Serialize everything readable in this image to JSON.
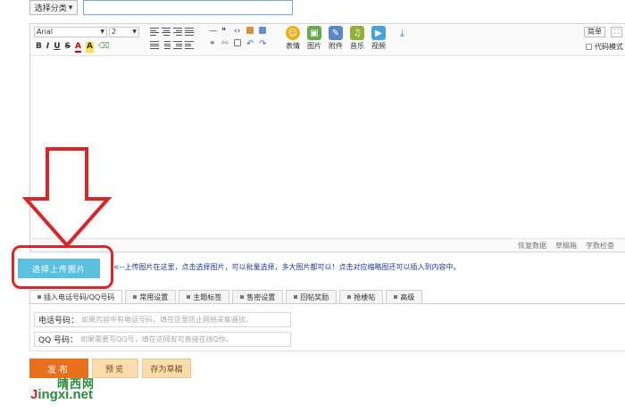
{
  "top": {
    "category_label": "选择分类",
    "category_arrow": "▾"
  },
  "toolbar": {
    "font_value": "Arial",
    "size_value": "2",
    "bold": "B",
    "italic": "I",
    "underline": "U",
    "strike": "S",
    "font_color": "A",
    "bg_color": "A",
    "media": [
      {
        "label": "表情",
        "color": "#e8b017",
        "glyph": "☺"
      },
      {
        "label": "图片",
        "color": "#6aa84f",
        "glyph": "▣"
      },
      {
        "label": "附件",
        "color": "#5b87c4",
        "glyph": "✎"
      },
      {
        "label": "音乐",
        "color": "#8fb33a",
        "glyph": "♫"
      },
      {
        "label": "视频",
        "color": "#4aa3d8",
        "glyph": "▶"
      }
    ],
    "simple_label": "简单",
    "code_mode_label": "代码模式"
  },
  "status_bar": {
    "restore": "恢复数据",
    "draft_box": "草稿箱",
    "word_check": "字数检查"
  },
  "upload": {
    "button_label": "选择上传图片",
    "hint": "<--上传图片在这里，点击选择图片，可以批量选择，多大图片都可以！点击对应缩略图还可以插入到内容中。"
  },
  "tabs": [
    {
      "label": "插入电话号码/QQ号码",
      "active": true
    },
    {
      "label": "常用设置",
      "active": false
    },
    {
      "label": "主题标签",
      "active": false
    },
    {
      "label": "售密设置",
      "active": false
    },
    {
      "label": "回帖奖励",
      "active": false
    },
    {
      "label": "抢楼帖",
      "active": false
    },
    {
      "label": "高级",
      "active": false
    }
  ],
  "fields": {
    "phone_label": "电话号码：",
    "phone_placeholder": "如果内容中有电话号码，填在这里防止网络采集骚扰。",
    "qq_label": "QQ 号码：",
    "qq_placeholder": "如果需要写QQ号，填在这网友可直接在线Q你。"
  },
  "actions": {
    "publish": "发布",
    "preview": "预览",
    "save_draft": "存为草稿"
  },
  "watermark": {
    "cn": "晴西网",
    "en_first": "J",
    "en_rest": "ingxi.net"
  },
  "colors": {
    "publish": "#e8701a",
    "upload": "#5bc0de",
    "annotation": "#d9262a"
  }
}
